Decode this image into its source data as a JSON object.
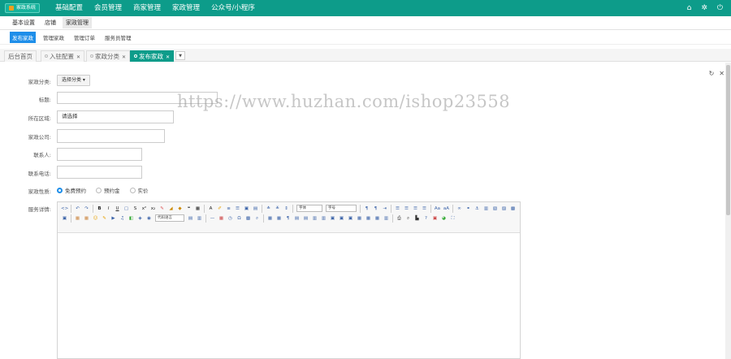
{
  "app": {
    "logo_text": "家政系统",
    "accent": "#0d9c8a"
  },
  "topnav": [
    "基础配置",
    "会员管理",
    "商家管理",
    "家政管理",
    "公众号/小程序"
  ],
  "topicons": [
    "home-icon",
    "gear-icon",
    "power-icon"
  ],
  "tabs1": [
    "基本设置",
    "店铺",
    "家政管理"
  ],
  "tabs2": [
    "发布家政",
    "管理家政",
    "管理订单",
    "服务员管理"
  ],
  "tabs3": {
    "home": "后台首页",
    "items": [
      "入驻配置",
      "家政分类",
      "发布家政"
    ]
  },
  "form": {
    "category_label": "家政分类:",
    "category_button": "选择分类 ▾",
    "title_label": "标题:",
    "area_label": "所在区域:",
    "area_value": "请选择",
    "company_label": "家政公司:",
    "contact_label": "联系人:",
    "phone_label": "联系电话:",
    "nature_label": "家政性质:",
    "nature_options": [
      "免费预约",
      "预约金",
      "实价"
    ],
    "nature_selected": "免费预约",
    "detail_label": "服务详情:"
  },
  "editor": {
    "font_select": "字体",
    "size_select": "字号",
    "code_select": "代码语言"
  },
  "watermark": "https://www.huzhan.com/ishop23558"
}
